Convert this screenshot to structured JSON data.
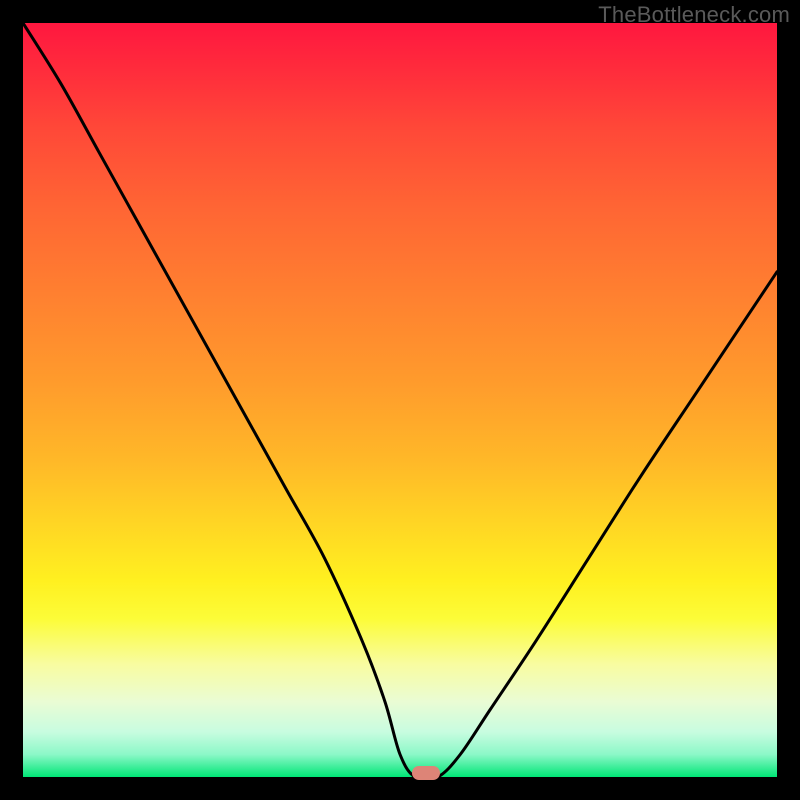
{
  "watermark": "TheBottleneck.com",
  "colors": {
    "frame": "#000000",
    "curve": "#000000",
    "marker": "#dd8477",
    "gradient_stops": [
      "#ff173f",
      "#ff2b3c",
      "#ff4838",
      "#ff6434",
      "#ff8030",
      "#ff9c2c",
      "#ffb828",
      "#ffd424",
      "#fff020",
      "#fcfc38",
      "#f8fca0",
      "#eafcd4",
      "#c8fce0",
      "#8cf8c8",
      "#00e676"
    ]
  },
  "chart_data": {
    "type": "line",
    "title": "",
    "xlabel": "",
    "ylabel": "",
    "xlim": [
      0,
      100
    ],
    "ylim": [
      0,
      100
    ],
    "grid": false,
    "legend": false,
    "annotations": [
      "TheBottleneck.com"
    ],
    "marker": {
      "x": 53.5,
      "y": 0.5
    },
    "series": [
      {
        "name": "curve",
        "x": [
          0,
          5,
          10,
          15,
          20,
          25,
          30,
          35,
          40,
          45,
          48,
          50,
          52,
          55,
          58,
          62,
          68,
          75,
          82,
          90,
          100
        ],
        "y": [
          100,
          92,
          83,
          74,
          65,
          56,
          47,
          38,
          29,
          18,
          10,
          3,
          0,
          0,
          3,
          9,
          18,
          29,
          40,
          52,
          67
        ]
      }
    ]
  }
}
